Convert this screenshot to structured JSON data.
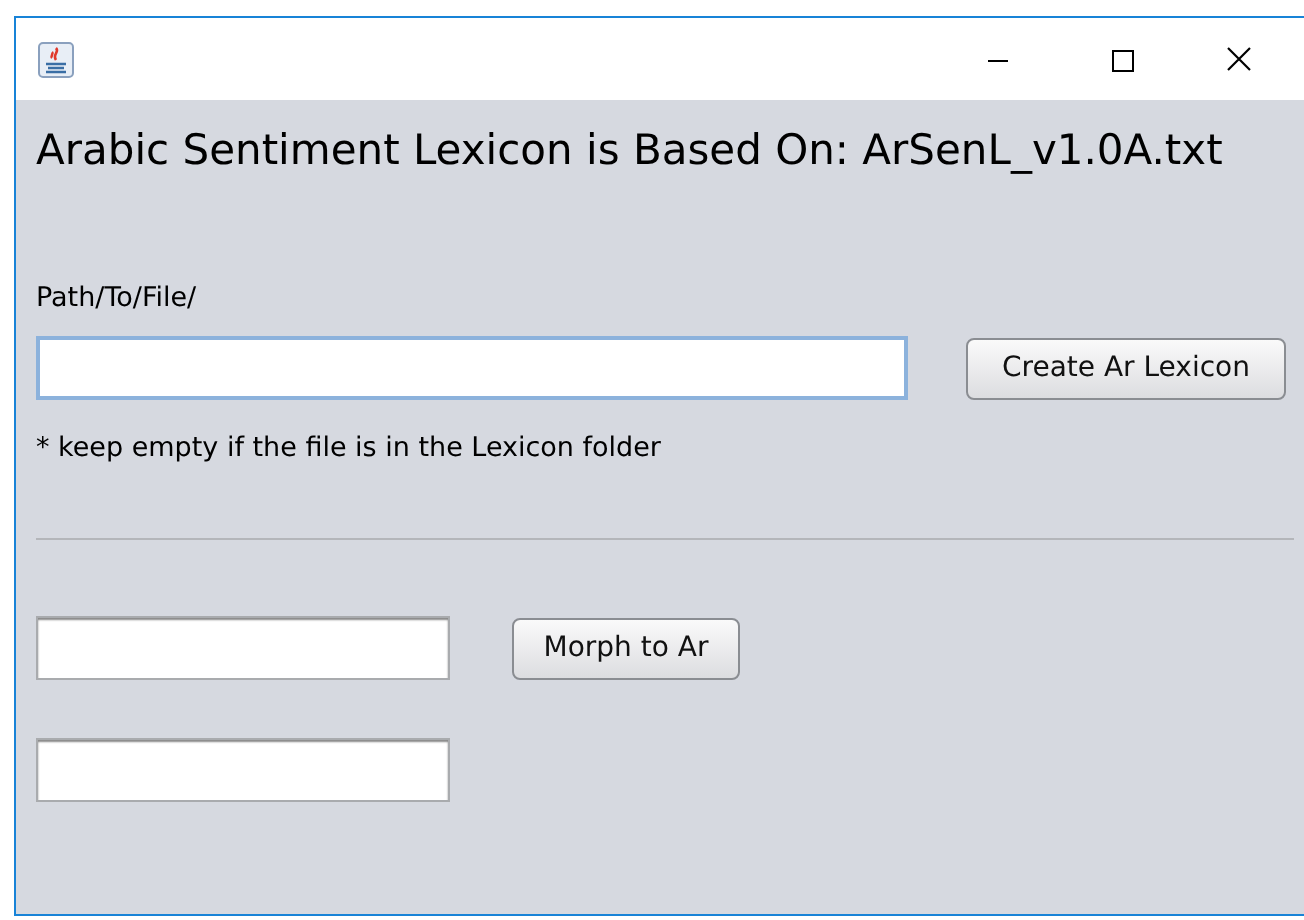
{
  "heading": "Arabic Sentiment Lexicon is Based On: ArSenL_v1.0A.txt",
  "path_label": "Path/To/File/",
  "path_field": {
    "focused": true
  },
  "create_button": "Create Ar Lexicon",
  "note": "* keep empty if the file is in the Lexicon folder",
  "morph_input": {
    "focused": false
  },
  "morph_button": "Morph to Ar",
  "morph_output": {
    "focused": false
  }
}
